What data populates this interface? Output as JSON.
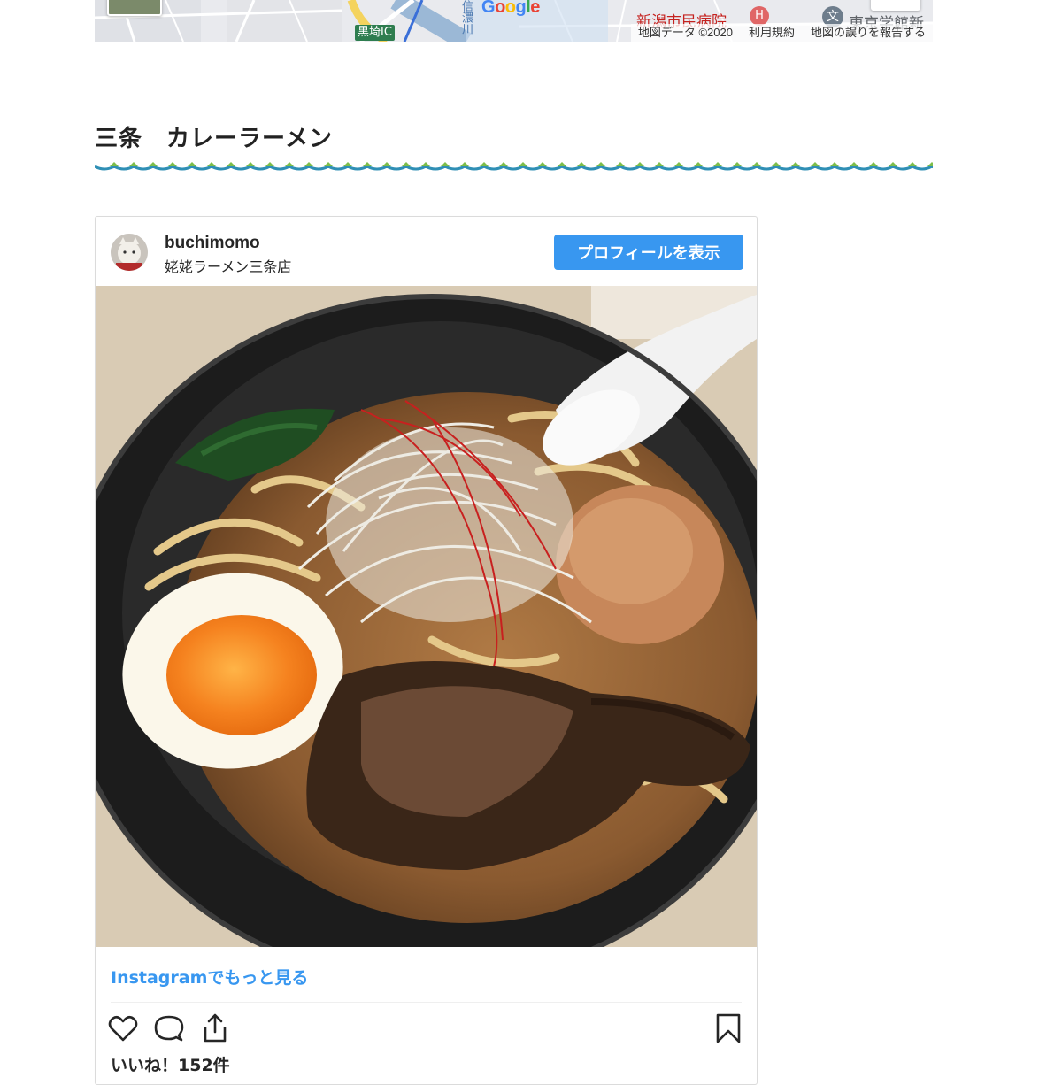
{
  "map": {
    "brand": [
      "G",
      "o",
      "o",
      "g",
      "l",
      "e"
    ],
    "poi_hospital": "新潟市民病院",
    "poi_school": "東京学館新",
    "interchange": "黒埼IC",
    "river": "信濃川",
    "hospital_symbol": "H",
    "school_symbol": "文",
    "footer": {
      "data": "地図データ ©2020",
      "terms": "利用規約",
      "report": "地図の誤りを報告する"
    }
  },
  "article": {
    "heading": "三条　カレーラーメン"
  },
  "instagram": {
    "username": "buchimomo",
    "location": "姥姥ラーメン三条店",
    "profile_button": "プロフィールを表示",
    "more_link": "Instagramでもっと見る",
    "likes": "いいね！152件",
    "icons": [
      "heart-icon",
      "comment-icon",
      "share-icon",
      "bookmark-icon"
    ]
  },
  "colors": {
    "instagram_blue": "#3897f0",
    "wave_blue": "#2f8fb5",
    "wave_green": "#7dbd4a"
  }
}
